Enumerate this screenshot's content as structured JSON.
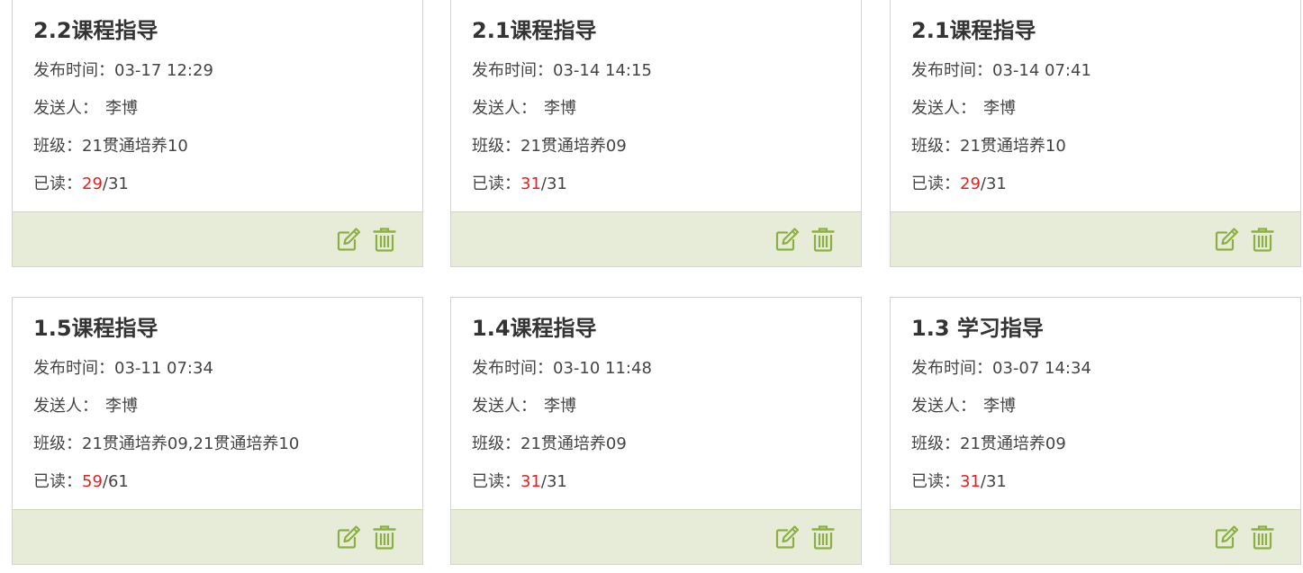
{
  "labels": {
    "publish_time": "发布时间：",
    "sender": "发送人：",
    "class": "班级：",
    "read": "已读：",
    "read_sep": "/"
  },
  "colors": {
    "footer_bg": "#e6ecd8",
    "icon": "#8bb041",
    "read_highlight": "#e02222"
  },
  "icons": {
    "edit": "edit-icon",
    "delete": "trash-icon"
  },
  "cards": [
    {
      "title": "2.2课程指导",
      "time": "03-17 12:29",
      "sender": "李博",
      "class": "21贯通培养10",
      "read": "29",
      "total": "31"
    },
    {
      "title": "2.1课程指导",
      "time": "03-14 14:15",
      "sender": "李博",
      "class": "21贯通培养09",
      "read": "31",
      "total": "31"
    },
    {
      "title": "2.1课程指导",
      "time": "03-14 07:41",
      "sender": "李博",
      "class": "21贯通培养10",
      "read": "29",
      "total": "31"
    },
    {
      "title": "1.5课程指导",
      "time": "03-11 07:34",
      "sender": "李博",
      "class": "21贯通培养09,21贯通培养10",
      "read": "59",
      "total": "61"
    },
    {
      "title": "1.4课程指导",
      "time": "03-10 11:48",
      "sender": "李博",
      "class": "21贯通培养09",
      "read": "31",
      "total": "31"
    },
    {
      "title": "1.3 学习指导",
      "time": "03-07 14:34",
      "sender": "李博",
      "class": "21贯通培养09",
      "read": "31",
      "total": "31"
    }
  ]
}
